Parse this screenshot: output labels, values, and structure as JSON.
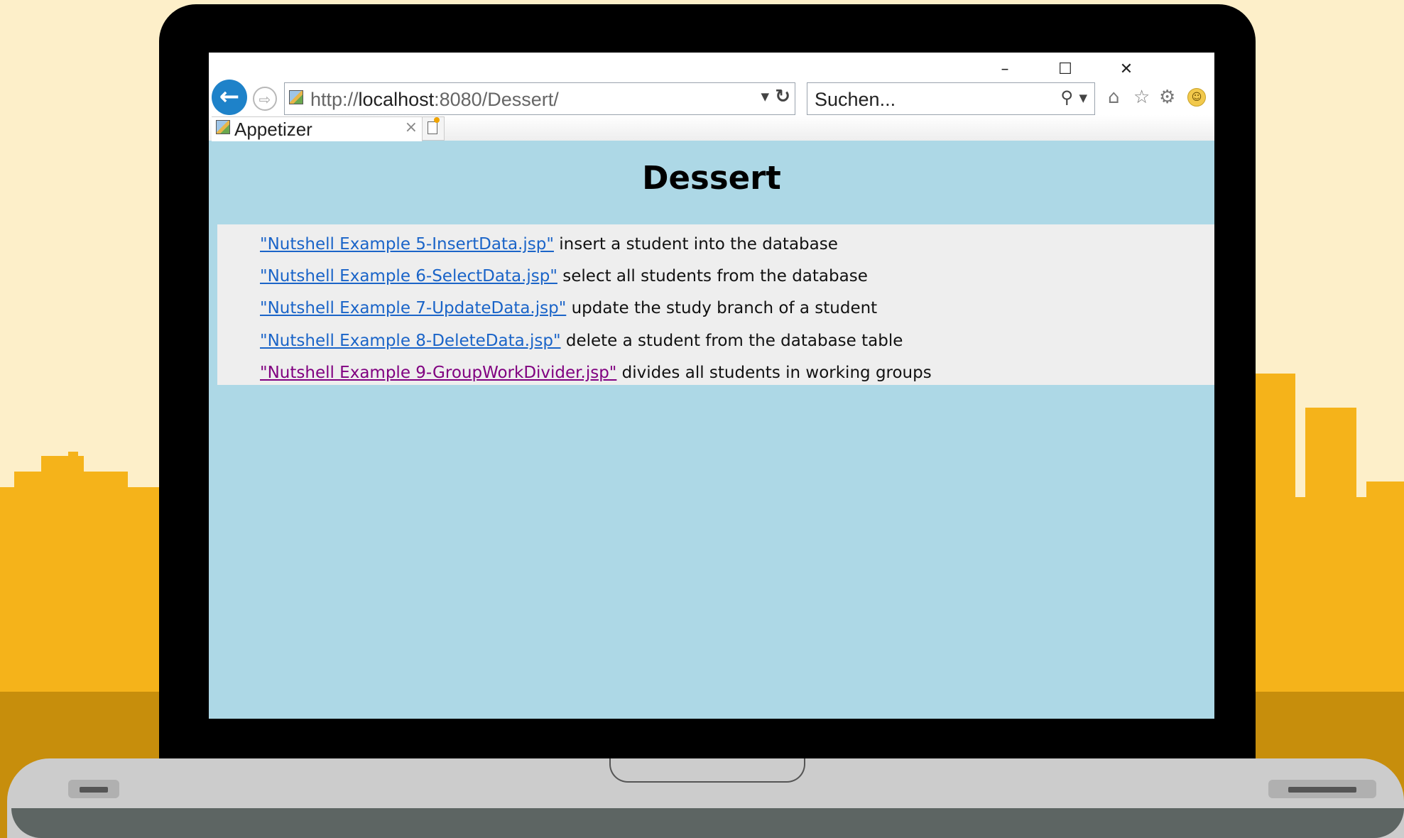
{
  "browser": {
    "address_bar": {
      "protocol": "http://",
      "host": "localhost",
      "rest": ":8080/Dessert/"
    },
    "search": {
      "placeholder": "Suchen..."
    },
    "tab": {
      "label": "Appetizer"
    },
    "window_controls": {
      "minimize": "–",
      "maximize": "☐",
      "close": "✕"
    }
  },
  "page": {
    "title": "Dessert",
    "items": [
      {
        "link": "\"Nutshell Example 5-InsertData.jsp\"",
        "desc": " insert a student into the database",
        "visited": false
      },
      {
        "link": "\"Nutshell Example 6-SelectData.jsp\"",
        "desc": " select all students from the database",
        "visited": false
      },
      {
        "link": "\"Nutshell Example 7-UpdateData.jsp\"",
        "desc": " update the study branch of a student",
        "visited": false
      },
      {
        "link": "\"Nutshell Example 8-DeleteData.jsp\"",
        "desc": " delete a student from the database table",
        "visited": false
      },
      {
        "link": "\"Nutshell Example 9-GroupWorkDivider.jsp\"",
        "desc": " divides all students in working groups",
        "visited": true
      }
    ]
  },
  "colors": {
    "page_background": "#add8e6",
    "list_background": "#eeeeee",
    "link": "#1a64c8",
    "visited_link": "#800080",
    "back_button": "#1e82c9"
  }
}
